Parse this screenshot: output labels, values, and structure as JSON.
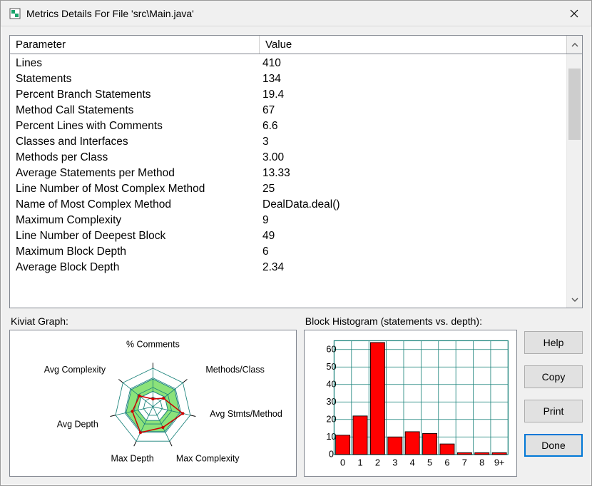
{
  "window": {
    "title": "Metrics Details For File 'src\\Main.java'"
  },
  "table": {
    "columns": {
      "param": "Parameter",
      "value": "Value"
    },
    "rows": [
      {
        "param": "Lines",
        "value": "410"
      },
      {
        "param": "Statements",
        "value": "134"
      },
      {
        "param": "Percent Branch Statements",
        "value": "19.4"
      },
      {
        "param": "Method Call Statements",
        "value": "67"
      },
      {
        "param": "Percent Lines with Comments",
        "value": "6.6"
      },
      {
        "param": "Classes and Interfaces",
        "value": "3"
      },
      {
        "param": "Methods per Class",
        "value": "3.00"
      },
      {
        "param": "Average Statements per Method",
        "value": "13.33"
      },
      {
        "param": "Line Number of Most Complex Method",
        "value": "25"
      },
      {
        "param": "Name of Most Complex Method",
        "value": "DealData.deal()"
      },
      {
        "param": "Maximum Complexity",
        "value": "9"
      },
      {
        "param": "Line Number of Deepest Block",
        "value": "49"
      },
      {
        "param": "Maximum Block Depth",
        "value": "6"
      },
      {
        "param": "Average Block Depth",
        "value": "2.34"
      }
    ]
  },
  "kiviat": {
    "label": "Kiviat Graph:",
    "axes": [
      "% Comments",
      "Methods/Class",
      "Avg Stmts/Method",
      "Max Complexity",
      "Max Depth",
      "Avg Depth",
      "Avg Complexity"
    ]
  },
  "histogram": {
    "label": "Block Histogram (statements vs. depth):"
  },
  "buttons": {
    "help": "Help",
    "copy": "Copy",
    "print": "Print",
    "done": "Done"
  },
  "chart_data": [
    {
      "type": "radar",
      "id": "kiviat",
      "title": "Kiviat Graph",
      "axes": [
        "% Comments",
        "Methods/Class",
        "Avg Stmts/Method",
        "Max Complexity",
        "Max Depth",
        "Avg Depth",
        "Avg Complexity"
      ],
      "values_normalized": [
        0.2,
        0.35,
        0.8,
        0.6,
        0.75,
        0.55,
        0.45
      ],
      "band_inner": 0.4,
      "band_outer": 0.72,
      "r_max": 1.0
    },
    {
      "type": "bar",
      "id": "block-histogram",
      "title": "Block Histogram (statements vs. depth)",
      "xlabel": "depth",
      "ylabel": "statements",
      "categories": [
        "0",
        "1",
        "2",
        "3",
        "4",
        "5",
        "6",
        "7",
        "8",
        "9+"
      ],
      "values": [
        11,
        22,
        64,
        10,
        13,
        12,
        6,
        1,
        1,
        1
      ],
      "ylim": [
        0,
        65
      ],
      "yticks": [
        0,
        10,
        20,
        30,
        40,
        50,
        60
      ]
    }
  ]
}
